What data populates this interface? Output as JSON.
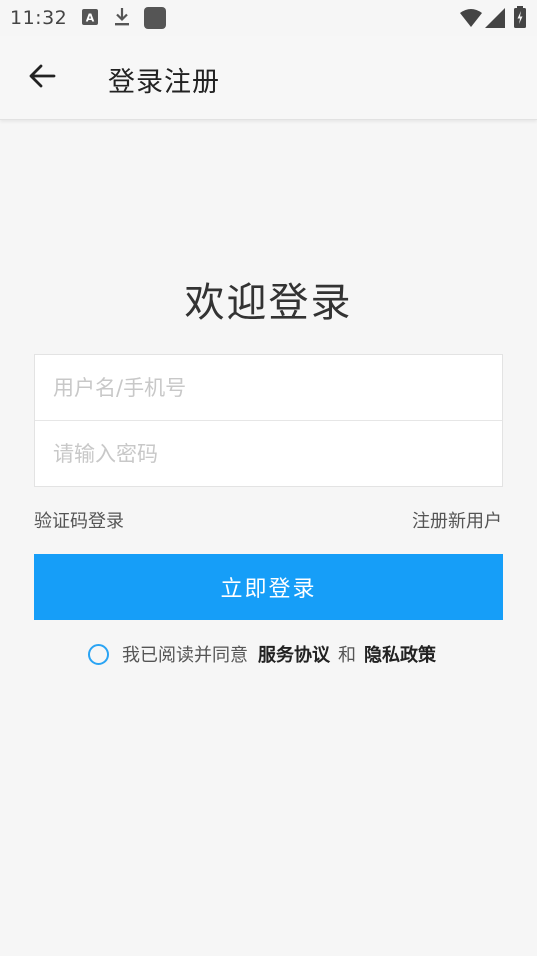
{
  "status_bar": {
    "time": "11:32",
    "left_icons": [
      "text-a-icon",
      "download-icon",
      "app-square-icon"
    ],
    "right_icons": [
      "wifi-icon",
      "signal-icon",
      "battery-icon"
    ]
  },
  "app_bar": {
    "back_icon": "arrow-left-icon",
    "title": "登录注册"
  },
  "welcome": "欢迎登录",
  "form": {
    "username_placeholder": "用户名/手机号",
    "username_value": "",
    "password_placeholder": "请输入密码",
    "password_value": ""
  },
  "links": {
    "sms_login": "验证码登录",
    "register": "注册新用户"
  },
  "login_button": "立即登录",
  "agreement": {
    "prefix": "我已阅读并同意",
    "service": "服务协议",
    "and": "和",
    "privacy": "隐私政策",
    "checked": false
  },
  "colors": {
    "primary": "#169ef8",
    "radio_border": "#2aa4f4",
    "background": "#f6f6f6"
  }
}
